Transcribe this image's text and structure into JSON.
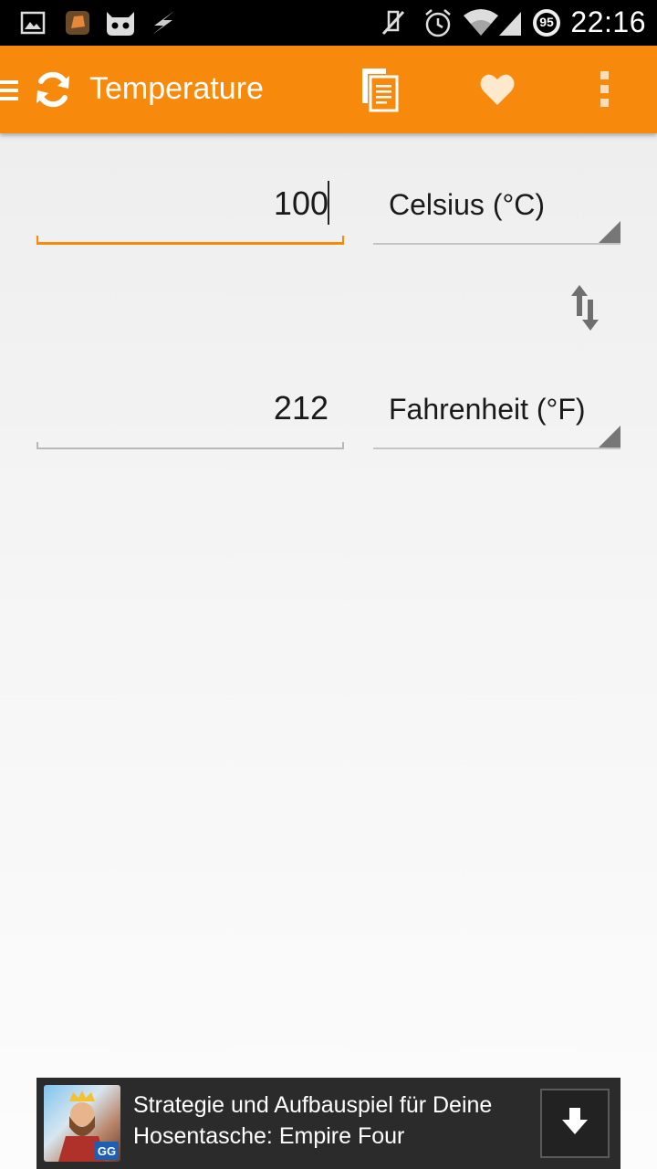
{
  "status_bar": {
    "time": "22:16",
    "battery_level": "95",
    "icons": [
      "gallery-icon",
      "app-notification-icon",
      "cyanogen-icon",
      "flash-icon",
      "mute-icon",
      "alarm-icon",
      "wifi-icon",
      "signal-icon",
      "battery-icon"
    ]
  },
  "action_bar": {
    "title": "Temperature",
    "color": "#f78a0c",
    "icons": [
      "menu-icon",
      "refresh-icon",
      "copy-icon",
      "favorite-icon",
      "overflow-menu-icon"
    ]
  },
  "converter": {
    "from": {
      "value": "100",
      "unit": "Celsius (°C)"
    },
    "to": {
      "value": "212",
      "unit": "Fahrenheit (°F)"
    },
    "swap_icon": "swap-icon"
  },
  "ad": {
    "text_line1": "Strategie und Aufbauspiel für Deine",
    "text_line2": "Hosentasche: Empire Four",
    "badge": "GG",
    "download_icon": "download-icon"
  }
}
